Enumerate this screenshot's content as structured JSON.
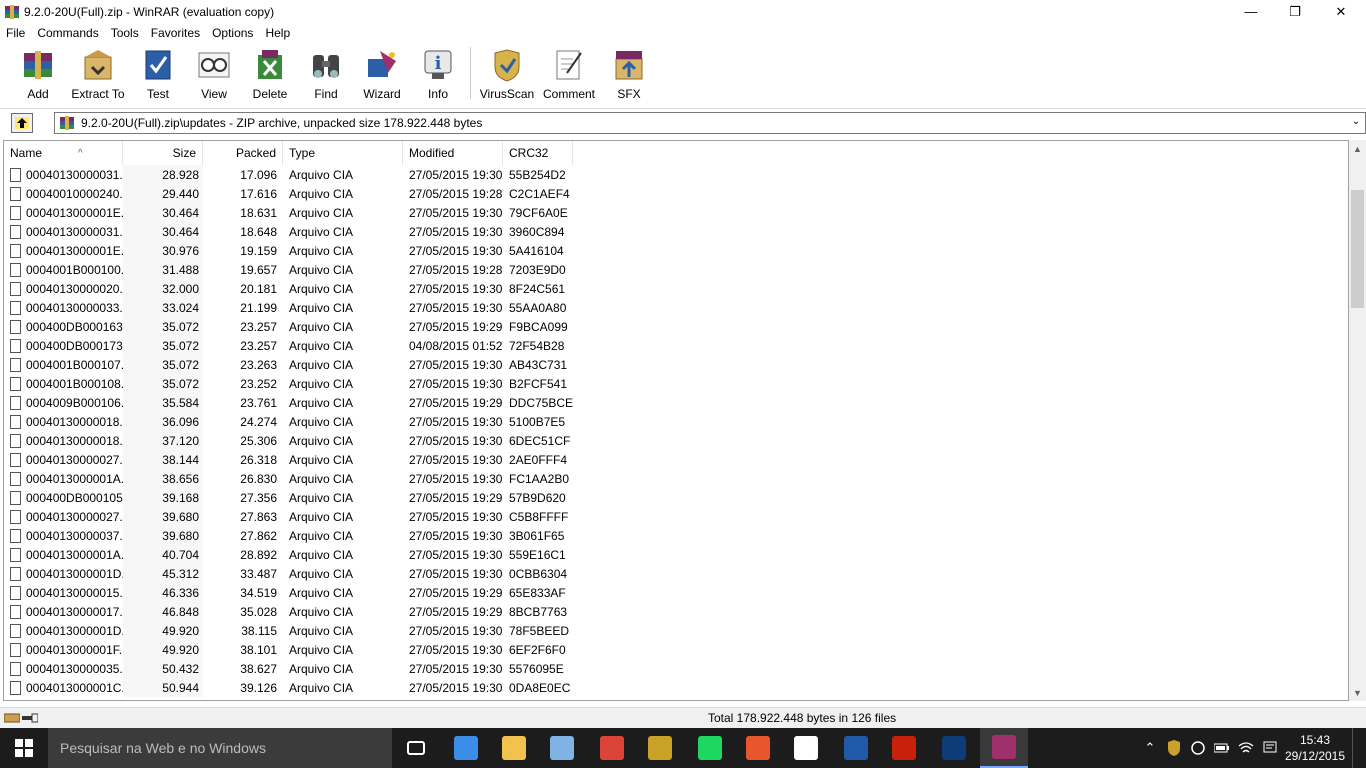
{
  "window": {
    "title": "9.2.0-20U(Full).zip - WinRAR (evaluation copy)",
    "minimize_glyph": "—",
    "maximize_glyph": "❐",
    "close_glyph": "✕"
  },
  "menu": [
    "File",
    "Commands",
    "Tools",
    "Favorites",
    "Options",
    "Help"
  ],
  "toolbar": {
    "buttons": [
      {
        "label": "Add",
        "icon": "add-archive-icon"
      },
      {
        "label": "Extract To",
        "icon": "extract-icon"
      },
      {
        "label": "Test",
        "icon": "test-icon"
      },
      {
        "label": "View",
        "icon": "view-icon"
      },
      {
        "label": "Delete",
        "icon": "delete-icon"
      },
      {
        "label": "Find",
        "icon": "find-icon"
      },
      {
        "label": "Wizard",
        "icon": "wizard-icon"
      },
      {
        "label": "Info",
        "icon": "info-icon"
      },
      {
        "label": "VirusScan",
        "icon": "virusscan-icon"
      },
      {
        "label": "Comment",
        "icon": "comment-icon"
      },
      {
        "label": "SFX",
        "icon": "sfx-icon"
      }
    ]
  },
  "address": {
    "path": "9.2.0-20U(Full).zip\\updates - ZIP archive, unpacked size 178.922.448 bytes",
    "dropdown_glyph": "⌄"
  },
  "columns": [
    "Name",
    "Size",
    "Packed",
    "Type",
    "Modified",
    "CRC32"
  ],
  "sort_indicator": "^",
  "files": [
    {
      "name": "00040130000031...",
      "size": "28.928",
      "packed": "17.096",
      "type": "Arquivo CIA",
      "modified": "27/05/2015 19:30",
      "crc": "55B254D2"
    },
    {
      "name": "00040010000240...",
      "size": "29.440",
      "packed": "17.616",
      "type": "Arquivo CIA",
      "modified": "27/05/2015 19:28",
      "crc": "C2C1AEF4"
    },
    {
      "name": "0004013000001E...",
      "size": "30.464",
      "packed": "18.631",
      "type": "Arquivo CIA",
      "modified": "27/05/2015 19:30",
      "crc": "79CF6A0E"
    },
    {
      "name": "00040130000031...",
      "size": "30.464",
      "packed": "18.648",
      "type": "Arquivo CIA",
      "modified": "27/05/2015 19:30",
      "crc": "3960C894"
    },
    {
      "name": "0004013000001E...",
      "size": "30.976",
      "packed": "19.159",
      "type": "Arquivo CIA",
      "modified": "27/05/2015 19:30",
      "crc": "5A416104"
    },
    {
      "name": "0004001B000100...",
      "size": "31.488",
      "packed": "19.657",
      "type": "Arquivo CIA",
      "modified": "27/05/2015 19:28",
      "crc": "7203E9D0"
    },
    {
      "name": "00040130000020...",
      "size": "32.000",
      "packed": "20.181",
      "type": "Arquivo CIA",
      "modified": "27/05/2015 19:30",
      "crc": "8F24C561"
    },
    {
      "name": "00040130000033...",
      "size": "33.024",
      "packed": "21.199",
      "type": "Arquivo CIA",
      "modified": "27/05/2015 19:30",
      "crc": "55AA0A80"
    },
    {
      "name": "000400DB000163...",
      "size": "35.072",
      "packed": "23.257",
      "type": "Arquivo CIA",
      "modified": "27/05/2015 19:29",
      "crc": "F9BCA099"
    },
    {
      "name": "000400DB000173...",
      "size": "35.072",
      "packed": "23.257",
      "type": "Arquivo CIA",
      "modified": "04/08/2015 01:52",
      "crc": "72F54B28"
    },
    {
      "name": "0004001B000107...",
      "size": "35.072",
      "packed": "23.263",
      "type": "Arquivo CIA",
      "modified": "27/05/2015 19:30",
      "crc": "AB43C731"
    },
    {
      "name": "0004001B000108...",
      "size": "35.072",
      "packed": "23.252",
      "type": "Arquivo CIA",
      "modified": "27/05/2015 19:30",
      "crc": "B2FCF541"
    },
    {
      "name": "0004009B000106...",
      "size": "35.584",
      "packed": "23.761",
      "type": "Arquivo CIA",
      "modified": "27/05/2015 19:29",
      "crc": "DDC75BCE"
    },
    {
      "name": "00040130000018...",
      "size": "36.096",
      "packed": "24.274",
      "type": "Arquivo CIA",
      "modified": "27/05/2015 19:30",
      "crc": "5100B7E5"
    },
    {
      "name": "00040130000018...",
      "size": "37.120",
      "packed": "25.306",
      "type": "Arquivo CIA",
      "modified": "27/05/2015 19:30",
      "crc": "6DEC51CF"
    },
    {
      "name": "00040130000027...",
      "size": "38.144",
      "packed": "26.318",
      "type": "Arquivo CIA",
      "modified": "27/05/2015 19:30",
      "crc": "2AE0FFF4"
    },
    {
      "name": "0004013000001A...",
      "size": "38.656",
      "packed": "26.830",
      "type": "Arquivo CIA",
      "modified": "27/05/2015 19:30",
      "crc": "FC1AA2B0"
    },
    {
      "name": "000400DB000105...",
      "size": "39.168",
      "packed": "27.356",
      "type": "Arquivo CIA",
      "modified": "27/05/2015 19:29",
      "crc": "57B9D620"
    },
    {
      "name": "00040130000027...",
      "size": "39.680",
      "packed": "27.863",
      "type": "Arquivo CIA",
      "modified": "27/05/2015 19:30",
      "crc": "C5B8FFFF"
    },
    {
      "name": "00040130000037...",
      "size": "39.680",
      "packed": "27.862",
      "type": "Arquivo CIA",
      "modified": "27/05/2015 19:30",
      "crc": "3B061F65"
    },
    {
      "name": "0004013000001A...",
      "size": "40.704",
      "packed": "28.892",
      "type": "Arquivo CIA",
      "modified": "27/05/2015 19:30",
      "crc": "559E16C1"
    },
    {
      "name": "0004013000001D...",
      "size": "45.312",
      "packed": "33.487",
      "type": "Arquivo CIA",
      "modified": "27/05/2015 19:30",
      "crc": "0CBB6304"
    },
    {
      "name": "00040130000015...",
      "size": "46.336",
      "packed": "34.519",
      "type": "Arquivo CIA",
      "modified": "27/05/2015 19:29",
      "crc": "65E833AF"
    },
    {
      "name": "00040130000017...",
      "size": "46.848",
      "packed": "35.028",
      "type": "Arquivo CIA",
      "modified": "27/05/2015 19:29",
      "crc": "8BCB7763"
    },
    {
      "name": "0004013000001D...",
      "size": "49.920",
      "packed": "38.115",
      "type": "Arquivo CIA",
      "modified": "27/05/2015 19:30",
      "crc": "78F5BEED"
    },
    {
      "name": "0004013000001F...",
      "size": "49.920",
      "packed": "38.101",
      "type": "Arquivo CIA",
      "modified": "27/05/2015 19:30",
      "crc": "6EF2F6F0"
    },
    {
      "name": "00040130000035...",
      "size": "50.432",
      "packed": "38.627",
      "type": "Arquivo CIA",
      "modified": "27/05/2015 19:30",
      "crc": "5576095E"
    },
    {
      "name": "0004013000001C...",
      "size": "50.944",
      "packed": "39.126",
      "type": "Arquivo CIA",
      "modified": "27/05/2015 19:30",
      "crc": "0DA8E0EC"
    }
  ],
  "scrollbar": {
    "up_glyph": "▲",
    "down_glyph": "▼"
  },
  "status": {
    "total": "Total 178.922.448 bytes in 126 files"
  },
  "taskbar": {
    "search_placeholder": "Pesquisar na Web e no Windows",
    "apps": [
      {
        "name": "task-view-icon",
        "color": "#ffffff"
      },
      {
        "name": "edge-icon",
        "color": "#3b8ee8"
      },
      {
        "name": "file-explorer-icon",
        "color": "#f2c14e"
      },
      {
        "name": "photos-icon",
        "color": "#7fb2e5"
      },
      {
        "name": "chrome-icon",
        "color": "#db4437"
      },
      {
        "name": "security-icon",
        "color": "#c9a227"
      },
      {
        "name": "spotify-icon",
        "color": "#1ed760"
      },
      {
        "name": "picture-app-icon",
        "color": "#e8572b"
      },
      {
        "name": "amazon-icon",
        "color": "#ffffff"
      },
      {
        "name": "photoshop-icon",
        "color": "#1f5aa8"
      },
      {
        "name": "flash-icon",
        "color": "#c9200c"
      },
      {
        "name": "video-editor-icon",
        "color": "#0e3c78"
      },
      {
        "name": "winrar-icon",
        "color": "#a0306c"
      }
    ],
    "clock_time": "15:43",
    "clock_date": "29/12/2015"
  },
  "colors": {
    "taskbar": "#1c1c1c",
    "search_box": "#3b3b3b",
    "accent": "#7aa7ff"
  }
}
